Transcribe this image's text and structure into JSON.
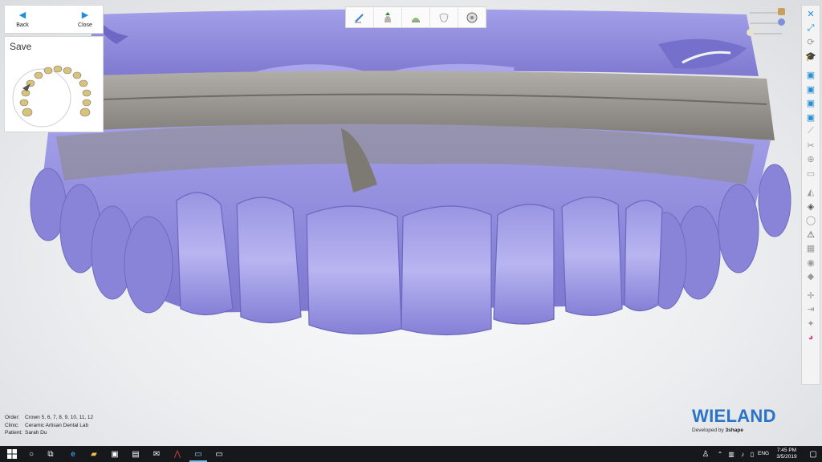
{
  "nav": {
    "back_label": "Back",
    "close_label": "Close"
  },
  "panel": {
    "title": "Save"
  },
  "steps": [
    {
      "icon": "pen-scan-icon"
    },
    {
      "icon": "crown-design-icon"
    },
    {
      "icon": "model-icon"
    },
    {
      "icon": "tooth-icon"
    },
    {
      "icon": "save-disc-icon"
    }
  ],
  "toolbar_icons": [
    "close-view-icon",
    "fit-view-icon",
    "rotate-view-icon",
    "education-icon",
    "layer-1-icon",
    "layer-2-icon",
    "layer-3-icon",
    "layer-4-icon",
    "measure-icon",
    "cut-icon",
    "zoom-icon",
    "clip-icon",
    "model-color-icon",
    "model-solid-icon",
    "tooth-ghost-icon",
    "warning-icon",
    "grid-icon",
    "camera-icon",
    "shading-icon",
    "axis-icon",
    "align-icon",
    "light-icon",
    "color-wheel-icon"
  ],
  "info": {
    "order_label": "Order:",
    "order_value": "Crown 5, 6, 7, 8, 9, 10, 11, 12",
    "clinic_label": "Clinic:",
    "clinic_value": "Ceramic Artisan Dental Lab",
    "patient_label": "Patient:",
    "patient_value": "Sarah Du"
  },
  "brand": {
    "name": "WIELAND",
    "developed_by": "Developed by",
    "company": "3shape"
  },
  "taskbar": {
    "time": "7:45 PM",
    "date": "3/5/2019",
    "language": "ENG"
  },
  "colors": {
    "accent": "#2a74c7",
    "model_purple": "#8c86d8",
    "gingiva_gray": "#8e8b86"
  }
}
